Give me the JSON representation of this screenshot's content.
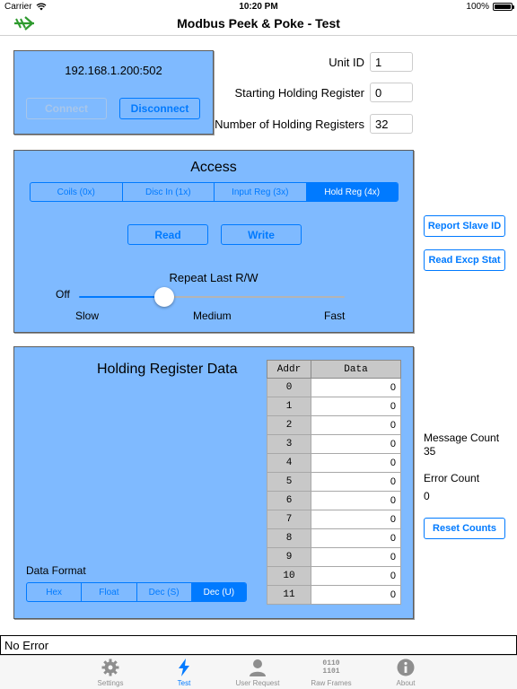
{
  "status_bar": {
    "carrier": "Carrier",
    "time": "10:20 PM",
    "battery": "100%"
  },
  "nav": {
    "title": "Modbus Peek & Poke - Test",
    "left_icon": "arrow-right-icon"
  },
  "connection": {
    "address": "192.168.1.200:502",
    "connect_label": "Connect",
    "disconnect_label": "Disconnect"
  },
  "fields": {
    "unit_id_label": "Unit ID",
    "unit_id_value": "1",
    "start_reg_label": "Starting Holding Register",
    "start_reg_value": "0",
    "num_regs_label": "Number of Holding Registers",
    "num_regs_value": "32"
  },
  "access": {
    "title": "Access",
    "segments": [
      "Coils (0x)",
      "Disc In (1x)",
      "Input Reg (3x)",
      "Hold Reg (4x)"
    ],
    "selected": 3,
    "read_label": "Read",
    "write_label": "Write",
    "repeat_label": "Repeat Last R/W",
    "slider_off": "Off",
    "slider_value": 0.32,
    "ticks": [
      "Slow",
      "Medium",
      "Fast"
    ]
  },
  "side_buttons": {
    "report_slave_id": "Report Slave ID",
    "read_excp_stat": "Read Excp Stat",
    "reset_counts": "Reset Counts"
  },
  "data": {
    "title": "Holding Register Data",
    "columns": [
      "Addr",
      "Data"
    ],
    "rows": [
      [
        "0",
        "0"
      ],
      [
        "1",
        "0"
      ],
      [
        "2",
        "0"
      ],
      [
        "3",
        "0"
      ],
      [
        "4",
        "0"
      ],
      [
        "5",
        "0"
      ],
      [
        "6",
        "0"
      ],
      [
        "7",
        "0"
      ],
      [
        "8",
        "0"
      ],
      [
        "9",
        "0"
      ],
      [
        "10",
        "0"
      ],
      [
        "11",
        "0"
      ]
    ],
    "format_label": "Data Format",
    "formats": [
      "Hex",
      "Float",
      "Dec (S)",
      "Dec (U)"
    ],
    "format_selected": 3
  },
  "stats": {
    "message_count_label": "Message Count",
    "message_count": "35",
    "error_count_label": "Error Count",
    "error_count": "0"
  },
  "error_bar": {
    "text": "No Error"
  },
  "tabs": [
    {
      "label": "Settings",
      "icon": "gear-icon"
    },
    {
      "label": "Test",
      "icon": "lightning-icon"
    },
    {
      "label": "User Request",
      "icon": "person-icon"
    },
    {
      "label": "Raw Frames",
      "icon": "binary-icon",
      "icon_text": [
        "0110",
        "1101"
      ]
    },
    {
      "label": "About",
      "icon": "info-icon"
    }
  ],
  "active_tab": 1,
  "colors": {
    "panel": "#7fbaff",
    "accent": "#007aff",
    "nav_icon": "#2e9a2e"
  }
}
